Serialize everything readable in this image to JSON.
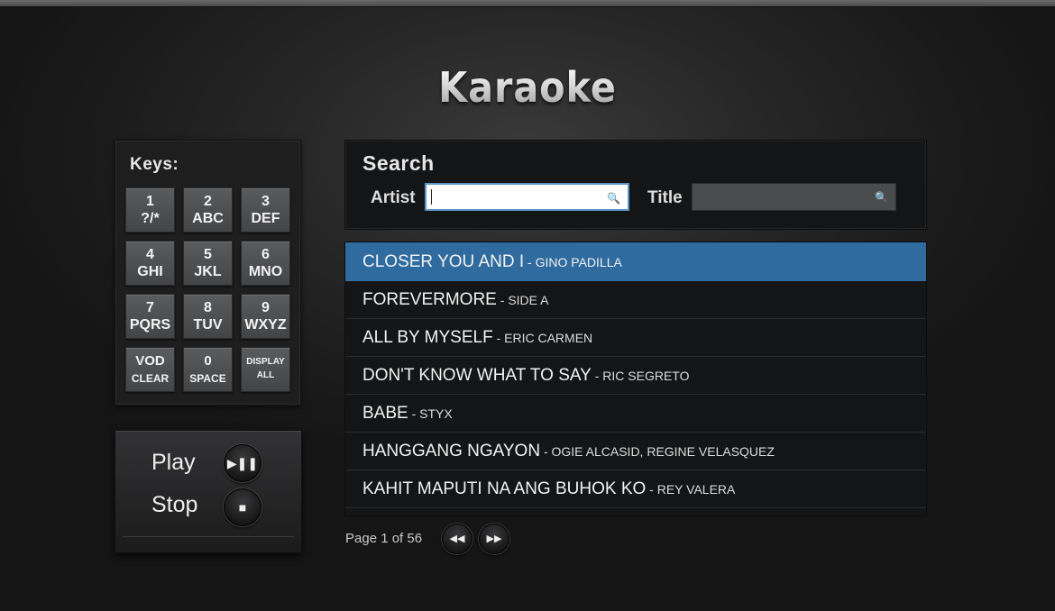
{
  "app": {
    "title": "Karaoke"
  },
  "keypad": {
    "title": "Keys:",
    "keys": [
      {
        "top": "1",
        "bottom": "?/*"
      },
      {
        "top": "2",
        "bottom": "ABC"
      },
      {
        "top": "3",
        "bottom": "DEF"
      },
      {
        "top": "4",
        "bottom": "GHI"
      },
      {
        "top": "5",
        "bottom": "JKL"
      },
      {
        "top": "6",
        "bottom": "MNO"
      },
      {
        "top": "7",
        "bottom": "PQRS"
      },
      {
        "top": "8",
        "bottom": "TUV"
      },
      {
        "top": "9",
        "bottom": "WXYZ"
      },
      {
        "top": "VOD",
        "bottom": "CLEAR"
      },
      {
        "top": "0",
        "bottom": "SPACE"
      },
      {
        "top": "DISPLAY",
        "bottom": "ALL"
      }
    ]
  },
  "transport": {
    "play_label": "Play",
    "stop_label": "Stop",
    "play_icon": "play-pause-icon",
    "stop_icon": "stop-icon"
  },
  "search": {
    "title": "Search",
    "artist_label": "Artist",
    "artist_value": "",
    "title_label": "Title",
    "title_value": "",
    "search_icon": "search-icon"
  },
  "songs": [
    {
      "title": "CLOSER YOU AND I",
      "artist": "GINO PADILLA",
      "selected": true
    },
    {
      "title": "FOREVERMORE",
      "artist": "SIDE A",
      "selected": false
    },
    {
      "title": "ALL BY MYSELF",
      "artist": "ERIC CARMEN",
      "selected": false
    },
    {
      "title": "DON'T KNOW WHAT TO SAY",
      "artist": "RIC SEGRETO",
      "selected": false
    },
    {
      "title": "BABE",
      "artist": "STYX",
      "selected": false
    },
    {
      "title": "HANGGANG NGAYON",
      "artist": "OGIE ALCASID, REGINE VELASQUEZ",
      "selected": false
    },
    {
      "title": "KAHIT MAPUTI NA ANG BUHOK KO",
      "artist": "REY VALERA",
      "selected": false
    }
  ],
  "song_separator": " - ",
  "pager": {
    "text": "Page 1 of 56",
    "prev_icon": "rewind-icon",
    "next_icon": "fast-forward-icon"
  },
  "colors": {
    "selected_row": "#2f6b9f",
    "focus_border": "#5c95c6",
    "background": "#1e1e1e"
  }
}
